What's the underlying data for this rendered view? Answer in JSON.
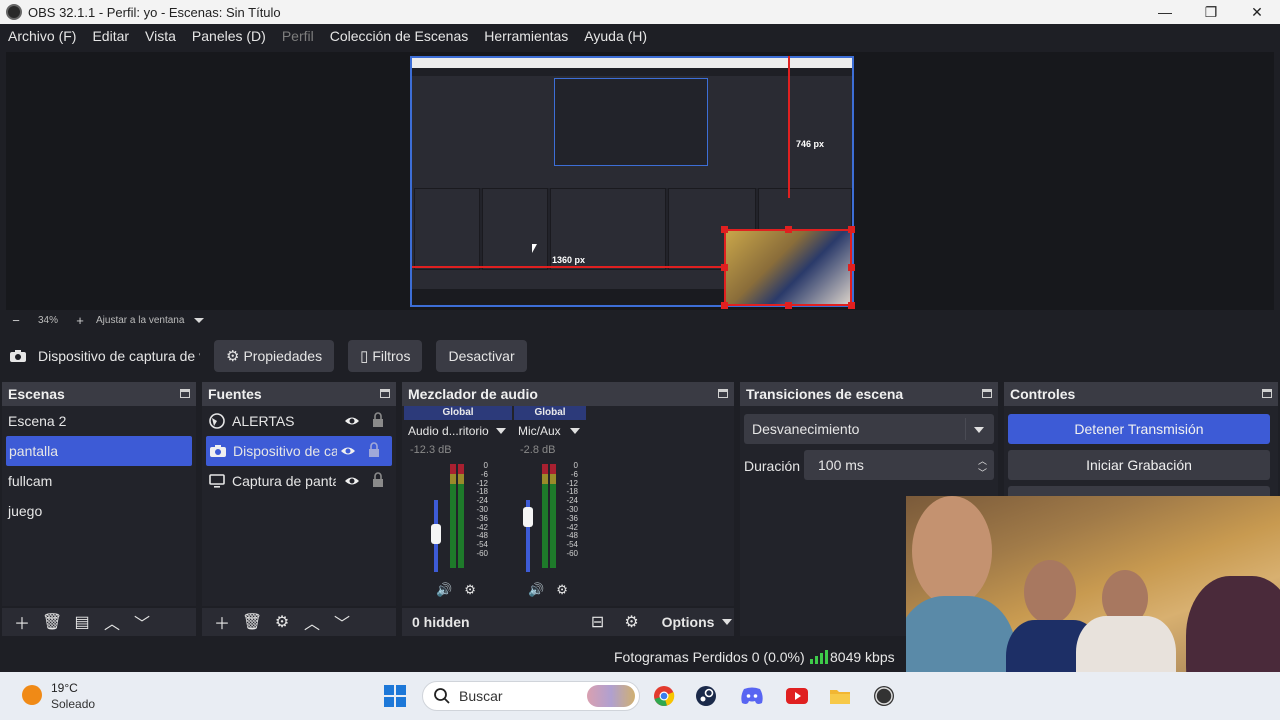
{
  "window": {
    "title": "OBS 32.1.1 - Perfil: yo - Escenas: Sin Título",
    "minimize": "—",
    "maximize": "❐",
    "close": "✕"
  },
  "menu": [
    {
      "label": "Archivo (F)",
      "enabled": true
    },
    {
      "label": "Editar",
      "enabled": true
    },
    {
      "label": "Vista",
      "enabled": true
    },
    {
      "label": "Paneles (D)",
      "enabled": true
    },
    {
      "label": "Perfil",
      "enabled": false
    },
    {
      "label": "Colección de Escenas",
      "enabled": true
    },
    {
      "label": "Herramientas",
      "enabled": true
    },
    {
      "label": "Ayuda (H)",
      "enabled": true
    }
  ],
  "preview": {
    "width_label": "746 px",
    "height_label": "1360 px"
  },
  "zoom": {
    "minus": "−",
    "value": "34%",
    "plus": "+",
    "fit_label": "Ajustar a la ventana"
  },
  "source_toolbar": {
    "source_name": "Dispositivo de captura de vídeo",
    "properties": "Propiedades",
    "filters": "Filtros",
    "deactivate": "Desactivar"
  },
  "scenes": {
    "title": "Escenas",
    "items": [
      "Escena 2",
      "pantalla",
      "fullcam",
      "juego"
    ],
    "selected_index": 1
  },
  "sources": {
    "title": "Fuentes",
    "items": [
      {
        "label": "ALERTAS",
        "icon": "globe-icon"
      },
      {
        "label": "Dispositivo de captura de vídeo",
        "icon": "camera-icon"
      },
      {
        "label": "Captura de pantalla",
        "icon": "monitor-icon"
      }
    ],
    "selected_index": 1
  },
  "mixer": {
    "title": "Mezclador de audio",
    "channels": [
      {
        "group": "Global",
        "name": "Audio d...ritorio",
        "db": "-12.3 dB",
        "volume": 0.62
      },
      {
        "group": "Global",
        "name": "Mic/Aux",
        "db": "-2.8 dB",
        "volume": 0.95
      }
    ],
    "scale": [
      "0",
      "-6",
      "-12",
      "-18",
      "-24",
      "-30",
      "-36",
      "-42",
      "-48",
      "-54",
      "-60"
    ],
    "hidden_label": "0 hidden",
    "options_label": "Options"
  },
  "transitions": {
    "title": "Transiciones de escena",
    "selected": "Desvanecimiento",
    "duration_label": "Duración",
    "duration_value": "100 ms"
  },
  "controls": {
    "title": "Controles",
    "stop_stream": "Detener Transmisión",
    "start_recording": "Iniciar Grabación"
  },
  "status": {
    "frames_dropped": "Fotogramas Perdidos 0 (0.0%)",
    "bitrate": "8049 kbps"
  },
  "taskbar": {
    "temperature": "19°C",
    "condition": "Soleado",
    "search_placeholder": "Buscar"
  },
  "colors": {
    "accent": "#3d5bd6",
    "panel_bg": "#22232a",
    "header_bg": "#3a3b44",
    "selection_red": "#e02020",
    "meter_green": "#1e7a2a"
  }
}
